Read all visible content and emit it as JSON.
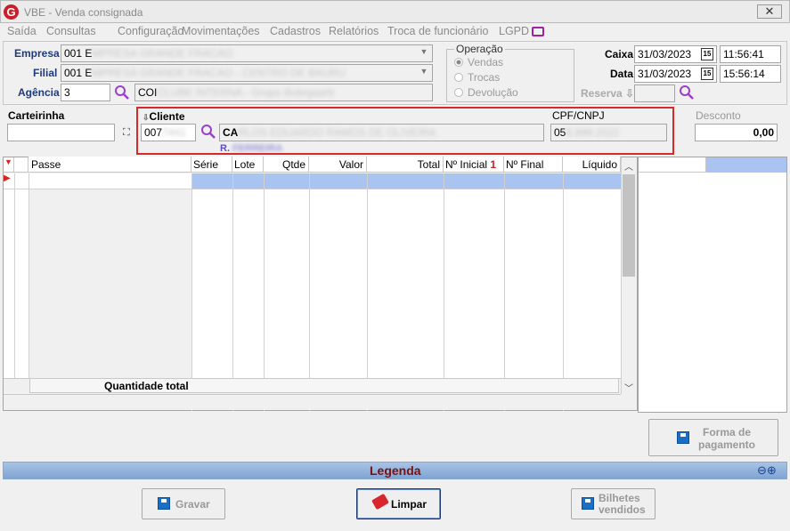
{
  "window": {
    "title": "VBE - Venda consignada",
    "logo_letter": "G",
    "close_glyph": "✕"
  },
  "menu": [
    "Saída",
    "Consultas",
    "Configuração",
    "Movimentações",
    "Cadastros",
    "Relatórios",
    "Troca de funcionário",
    "LGPD"
  ],
  "header": {
    "empresa_label": "Empresa",
    "empresa_code": "001 E",
    "empresa_name": "MPRESA GRANDE FRACAO",
    "filial_label": "Filial",
    "filial_code": "001 E",
    "filial_name": "MPRESA GRANDE FRACAO - CENTRO DE BAURU",
    "agencia_label": "Agência",
    "agencia_value": "3",
    "agencia_name_prefix": "COI",
    "agencia_name_rest": "CLUBE INTERNA - Grupo Bobrgaarb",
    "operacao_label": "Operação",
    "operacao_options": [
      "Vendas",
      "Trocas",
      "Devolução"
    ],
    "caixa_label": "Caixa",
    "caixa_date": "31/03/2023",
    "caixa_time": "11:56:41",
    "data_label": "Data",
    "data_date": "31/03/2023",
    "data_time": "15:56:14",
    "reserva_label": "Reserva",
    "calendar_glyph": "15"
  },
  "cliente": {
    "carteirinha_label": "Carteirinha",
    "cliente_label": "Cliente",
    "cliente_code": "007",
    "cliente_code_rest": "7441",
    "cliente_name_prefix": "CA",
    "cliente_name_rest": "RLOS EDUARDO RAMOS DE OLIVEIRA",
    "cliente_sub": "R. ",
    "cliente_sub_rest": "FERREIRA",
    "cpf_label": "CPF/CNPJ",
    "cpf_prefix": "05",
    "cpf_rest": "8.899.2022",
    "desconto_label": "Desconto",
    "desconto_value": "0,00"
  },
  "grid": {
    "columns": [
      "Passe",
      "Série",
      "Lote",
      "Qtde",
      "Valor",
      "Total",
      "Nº Inicial",
      "Nº Final",
      "Líquido"
    ],
    "total_label": "Quantidade total",
    "sort_glyph": "1"
  },
  "buttons": {
    "forma_pagamento": "Forma de pagamento",
    "gravar": "Gravar",
    "limpar": "Limpar",
    "bilhetes": "Bilhetes vendidos"
  },
  "legenda": "Legenda",
  "colors": {
    "accent": "#1f3a7a",
    "highlight_row": "#a9c4f0",
    "red_box": "#d62a2a",
    "legenda_bar": "#8aaed8"
  }
}
